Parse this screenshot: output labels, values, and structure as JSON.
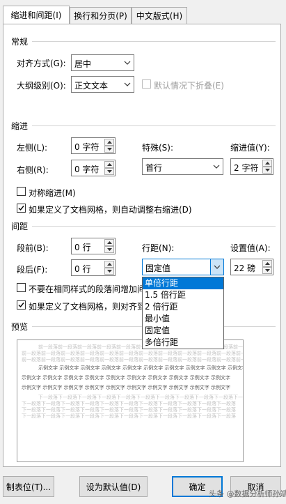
{
  "tabs": [
    {
      "label": "缩进和间距(I)",
      "active": true
    },
    {
      "label": "换行和分页(P)",
      "active": false
    },
    {
      "label": "中文版式(H)",
      "active": false
    }
  ],
  "general": {
    "title": "常规",
    "alignment_label": "对齐方式(G):",
    "alignment_value": "居中",
    "outline_label": "大纲级别(O):",
    "outline_value": "正文文本",
    "collapse_label": "默认情况下折叠(E)"
  },
  "indent": {
    "title": "缩进",
    "left_label": "左侧(L):",
    "left_value": "0 字符",
    "right_label": "右侧(R):",
    "right_value": "0 字符",
    "special_label": "特殊(S):",
    "special_value": "首行",
    "by_label": "缩进值(Y):",
    "by_value": "2 字符",
    "mirror_label": "对称缩进(M)",
    "mirror_checked": false,
    "auto_adjust_label": "如果定义了文档网格，则自动调整右缩进(D)",
    "auto_adjust_checked": true
  },
  "spacing": {
    "title": "间距",
    "before_label": "段前(B):",
    "before_value": "0 行",
    "after_label": "段后(F):",
    "after_value": "0 行",
    "line_label": "行距(N):",
    "line_value": "固定值",
    "at_label": "设置值(A):",
    "at_value": "22 磅",
    "no_space_label": "不要在相同样式的段落间增加间",
    "no_space_checked": false,
    "snap_label": "如果定义了文档网格，则对齐到",
    "snap_checked": true
  },
  "line_spacing_options": [
    "单倍行距",
    "1.5 倍行距",
    "2 倍行距",
    "最小值",
    "固定值",
    "多倍行距"
  ],
  "line_spacing_highlighted": 0,
  "preview": {
    "title": "预览",
    "prev_para": "前一段落前一段落前一段落前一段落前一段落前一段落前一段落前一段落前一段落前一段落前一段落前一段落",
    "sample_text": "示例文字 示例文字 示例文字 示例文字 示例文字 示例文字 示例文字 示例文字 示例文字 示例文字",
    "next_para": "下一段落下一段落下一段落下一段落下一段落下一段落下一段落下一段落下一段落下一段落下一段落"
  },
  "buttons": {
    "tabs": "制表位(T)...",
    "default": "设为默认值(D)",
    "ok": "确定",
    "cancel": "取消"
  },
  "watermark": "头条 @数据分析师孙斌"
}
